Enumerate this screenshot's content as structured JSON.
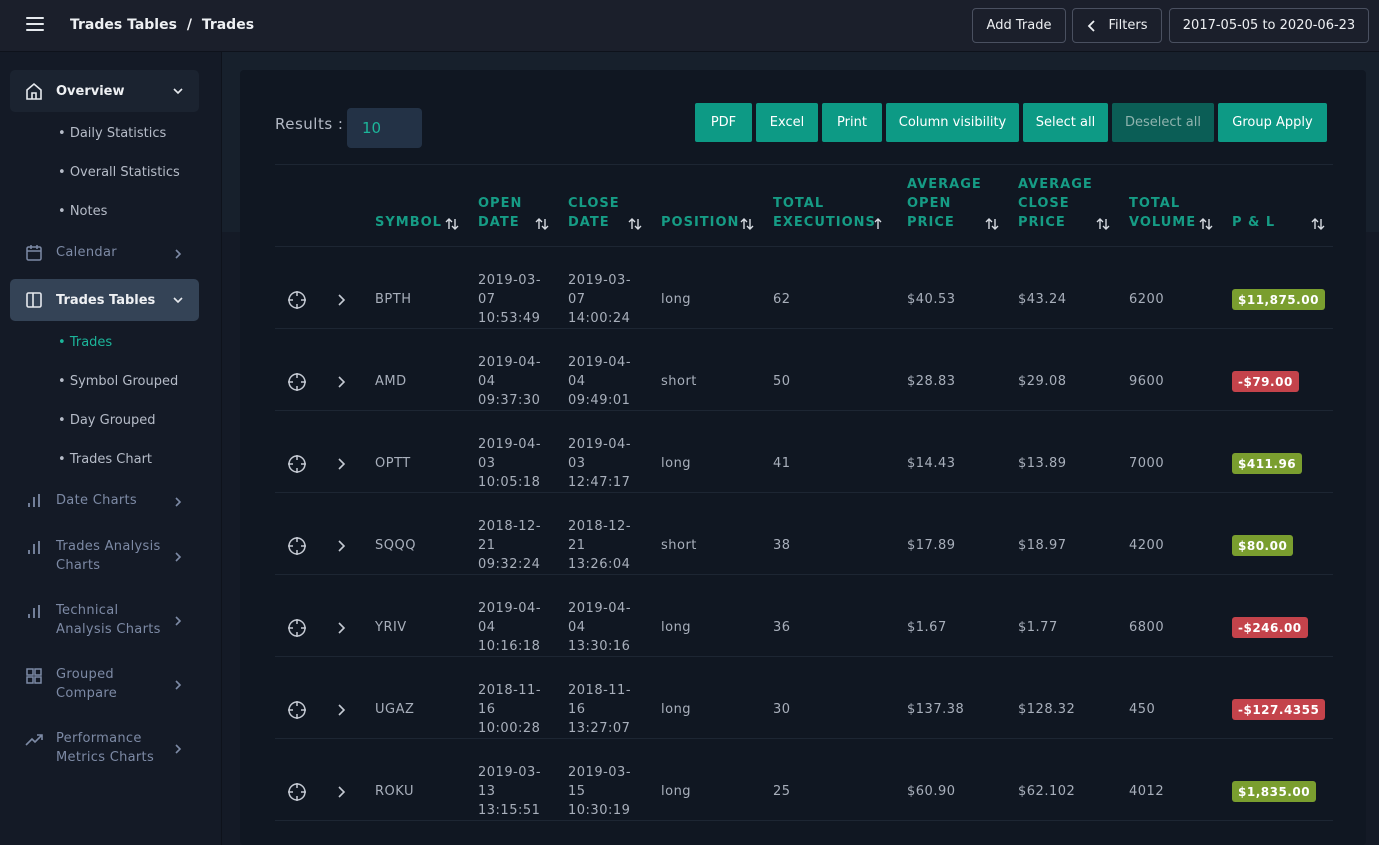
{
  "header": {
    "breadcrumb_parent": "Trades Tables",
    "breadcrumb_sep": "/",
    "breadcrumb_current": "Trades",
    "add_trade": "Add Trade",
    "filters": "Filters",
    "date_range": "2017-05-05 to 2020-06-23"
  },
  "sidebar": {
    "overview": "Overview",
    "overview_sub": [
      "Daily Statistics",
      "Overall Statistics",
      "Notes"
    ],
    "calendar": "Calendar",
    "trades_tables": "Trades Tables",
    "trades_sub": [
      "Trades",
      "Symbol Grouped",
      "Day Grouped",
      "Trades Chart"
    ],
    "date_charts": "Date Charts",
    "trades_analysis": [
      "Trades Analysis",
      "Charts"
    ],
    "technical_analysis": [
      "Technical",
      "Analysis Charts"
    ],
    "grouped_compare": [
      "Grouped",
      "Compare"
    ],
    "performance": [
      "Performance",
      "Metrics Charts"
    ]
  },
  "toolbar": {
    "results_label": "Results :",
    "results_value": "10",
    "buttons": [
      "PDF",
      "Excel",
      "Print",
      "Column visibility",
      "Select all",
      "Deselect all",
      "Group Apply"
    ]
  },
  "table": {
    "headers": [
      [
        "SYMBOL"
      ],
      [
        "OPEN",
        "DATE"
      ],
      [
        "CLOSE",
        "DATE"
      ],
      [
        "POSITION"
      ],
      [
        "TOTAL",
        "EXECUTIONS"
      ],
      [
        "AVERAGE",
        "OPEN",
        "PRICE"
      ],
      [
        "AVERAGE",
        "CLOSE",
        "PRICE"
      ],
      [
        "TOTAL",
        "VOLUME"
      ],
      [
        "P & L"
      ]
    ],
    "rows": [
      {
        "symbol": "BPTH",
        "open": [
          "2019-03-",
          "07",
          "10:53:49"
        ],
        "close": [
          "2019-03-",
          "07",
          "14:00:24"
        ],
        "position": "long",
        "executions": "62",
        "avg_open": "$40.53",
        "avg_close": "$43.24",
        "volume": "6200",
        "pl": "$11,875.00",
        "positive": true
      },
      {
        "symbol": "AMD",
        "open": [
          "2019-04-",
          "04",
          "09:37:30"
        ],
        "close": [
          "2019-04-",
          "04",
          "09:49:01"
        ],
        "position": "short",
        "executions": "50",
        "avg_open": "$28.83",
        "avg_close": "$29.08",
        "volume": "9600",
        "pl": "-$79.00",
        "positive": false
      },
      {
        "symbol": "OPTT",
        "open": [
          "2019-04-",
          "03",
          "10:05:18"
        ],
        "close": [
          "2019-04-",
          "03",
          "12:47:17"
        ],
        "position": "long",
        "executions": "41",
        "avg_open": "$14.43",
        "avg_close": "$13.89",
        "volume": "7000",
        "pl": "$411.96",
        "positive": true
      },
      {
        "symbol": "SQQQ",
        "open": [
          "2018-12-",
          "21",
          "09:32:24"
        ],
        "close": [
          "2018-12-",
          "21",
          "13:26:04"
        ],
        "position": "short",
        "executions": "38",
        "avg_open": "$17.89",
        "avg_close": "$18.97",
        "volume": "4200",
        "pl": "$80.00",
        "positive": true
      },
      {
        "symbol": "YRIV",
        "open": [
          "2019-04-",
          "04",
          "10:16:18"
        ],
        "close": [
          "2019-04-",
          "04",
          "13:30:16"
        ],
        "position": "long",
        "executions": "36",
        "avg_open": "$1.67",
        "avg_close": "$1.77",
        "volume": "6800",
        "pl": "-$246.00",
        "positive": false
      },
      {
        "symbol": "UGAZ",
        "open": [
          "2018-11-",
          "16",
          "10:00:28"
        ],
        "close": [
          "2018-11-",
          "16",
          "13:27:07"
        ],
        "position": "long",
        "executions": "30",
        "avg_open": "$137.38",
        "avg_close": "$128.32",
        "volume": "450",
        "pl": "-$127.4355",
        "positive": false
      },
      {
        "symbol": "ROKU",
        "open": [
          "2019-03-",
          "13",
          "13:15:51"
        ],
        "close": [
          "2019-03-",
          "15",
          "10:30:19"
        ],
        "position": "long",
        "executions": "25",
        "avg_open": "$60.90",
        "avg_close": "$62.102",
        "volume": "4012",
        "pl": "$1,835.00",
        "positive": true
      }
    ]
  },
  "colors": {
    "accent": "#0d9a85",
    "positive_badge": "#7a9e2f",
    "negative_badge": "#c4434b"
  }
}
